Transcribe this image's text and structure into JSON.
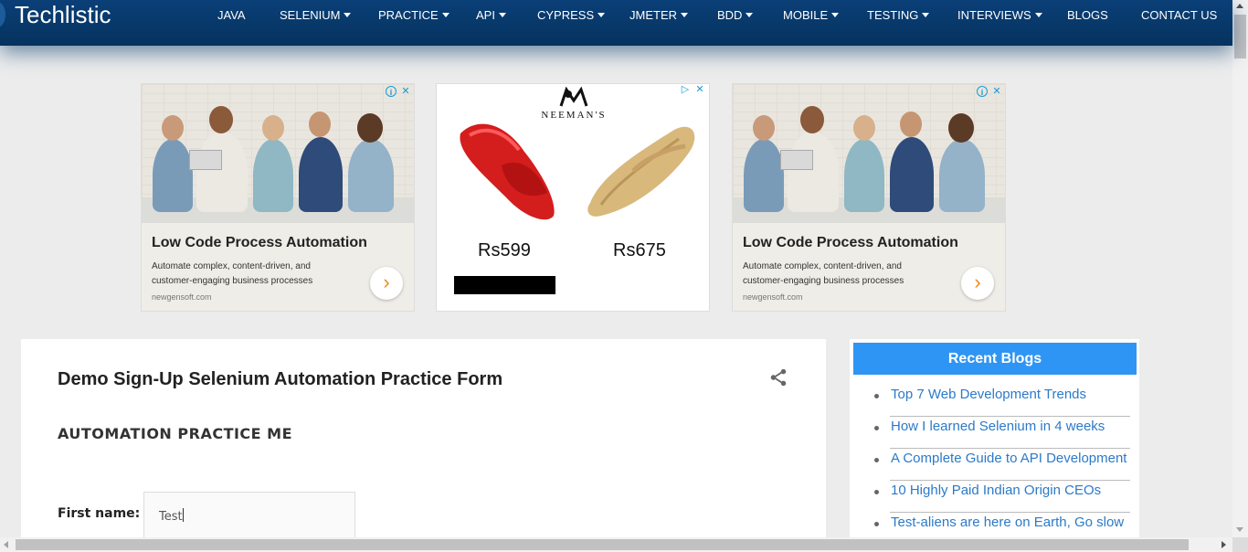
{
  "site": {
    "brand": "Techlistic"
  },
  "nav": {
    "items": [
      {
        "label": "JAVA",
        "dropdown": false
      },
      {
        "label": "SELENIUM",
        "dropdown": true
      },
      {
        "label": "PRACTICE",
        "dropdown": true
      },
      {
        "label": "API",
        "dropdown": true
      },
      {
        "label": "CYPRESS",
        "dropdown": true
      },
      {
        "label": "JMETER",
        "dropdown": true
      },
      {
        "label": "BDD",
        "dropdown": true
      },
      {
        "label": "MOBILE",
        "dropdown": true
      },
      {
        "label": "TESTING",
        "dropdown": true
      },
      {
        "label": "INTERVIEWS",
        "dropdown": true
      },
      {
        "label": "BLOGS",
        "dropdown": false
      },
      {
        "label": "CONTACT US",
        "dropdown": false
      }
    ]
  },
  "ads": {
    "left": {
      "title": "Low Code Process Automation",
      "description": "Automate complex, content-driven, and customer-engaging business processes",
      "domain": "newgensoft.com",
      "cta_icon": "chevron-right-icon"
    },
    "middle": {
      "brand": "NEEMAN'S",
      "price_1": "Rs599",
      "price_2": "Rs675"
    },
    "right": {
      "title": "Low Code Process Automation",
      "description": "Automate complex, content-driven, and customer-engaging business processes",
      "domain": "newgensoft.com",
      "cta_icon": "chevron-right-icon"
    }
  },
  "post": {
    "title": "Demo Sign-Up Selenium Automation Practice Form",
    "section_heading": "AUTOMATION PRACTICE ME",
    "first_name_label": "First name:",
    "first_name_value": "Test"
  },
  "sidebar": {
    "heading": "Recent Blogs",
    "blogs": [
      "Top 7 Web Development Trends",
      "How I learned Selenium in 4 weeks",
      "A Complete Guide to API Development",
      "10 Highly Paid Indian Origin CEOs",
      "Test-aliens are here on Earth, Go slow"
    ]
  },
  "colors": {
    "nav_bg": "#06335f",
    "sidebar_header": "#2f95f4",
    "link": "#2b7ac9",
    "cta_arrow": "#f08a1f"
  }
}
